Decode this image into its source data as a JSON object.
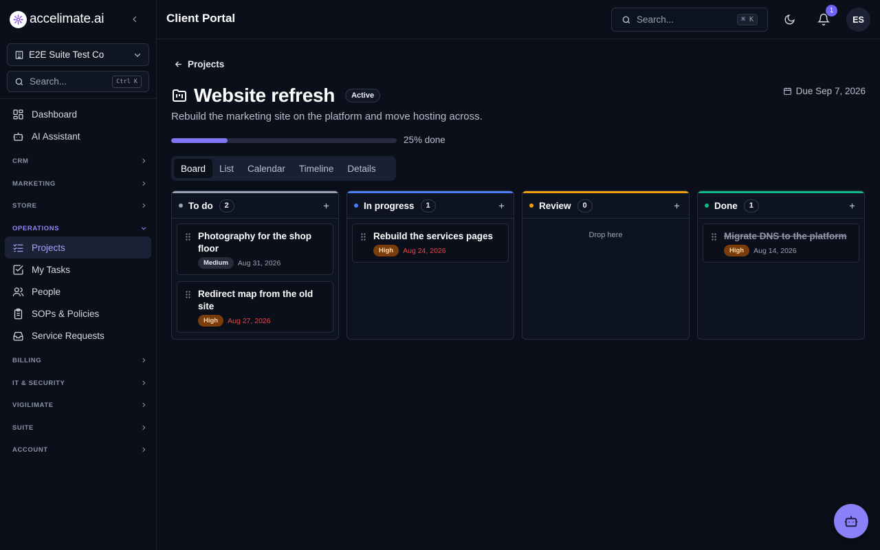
{
  "brand": {
    "name": "accelimate.ai"
  },
  "org": {
    "name": "E2E Suite Test Co"
  },
  "sidebar_search": {
    "placeholder": "Search...",
    "shortcut": "Ctrl K"
  },
  "sidebar": {
    "top_items": [
      {
        "label": "Dashboard",
        "icon": "dashboard-icon"
      },
      {
        "label": "AI Assistant",
        "icon": "robot-icon"
      }
    ],
    "sections": [
      {
        "label": "CRM"
      },
      {
        "label": "MARKETING"
      },
      {
        "label": "STORE"
      },
      {
        "label": "OPERATIONS"
      },
      {
        "label": "BILLING"
      },
      {
        "label": "IT & SECURITY"
      },
      {
        "label": "VIGILIMATE"
      },
      {
        "label": "SUITE"
      },
      {
        "label": "ACCOUNT"
      }
    ],
    "operations_items": [
      {
        "label": "Projects",
        "icon": "list-checks-icon",
        "active": true
      },
      {
        "label": "My Tasks",
        "icon": "square-check-icon"
      },
      {
        "label": "People",
        "icon": "users-icon"
      },
      {
        "label": "SOPs & Policies",
        "icon": "clipboard-icon"
      },
      {
        "label": "Service Requests",
        "icon": "inbox-icon"
      }
    ]
  },
  "topbar": {
    "title": "Client Portal",
    "search_placeholder": "Search...",
    "search_shortcut": "⌘ K",
    "notification_count": "1",
    "avatar_initials": "ES"
  },
  "project": {
    "back_label": "Projects",
    "title": "Website refresh",
    "status": "Active",
    "due": "Due Sep 7, 2026",
    "description": "Rebuild the marketing site on the platform and move hosting across.",
    "progress_percent": 25,
    "progress_label": "25% done"
  },
  "tabs": [
    {
      "label": "Board",
      "active": true
    },
    {
      "label": "List"
    },
    {
      "label": "Calendar"
    },
    {
      "label": "Timeline"
    },
    {
      "label": "Details"
    }
  ],
  "board": {
    "drop_label": "Drop here",
    "columns": [
      {
        "title": "To do",
        "count": "2",
        "color": "#9aa3b5",
        "cards": [
          {
            "title": "Photography for the shop floor",
            "priority": "Medium",
            "date": "Aug 31, 2026",
            "overdue": false
          },
          {
            "title": "Redirect map from the old site",
            "priority": "High",
            "date": "Aug 27, 2026",
            "overdue": true
          }
        ]
      },
      {
        "title": "In progress",
        "count": "1",
        "color": "#4f7cf7",
        "cards": [
          {
            "title": "Rebuild the services pages",
            "priority": "High",
            "date": "Aug 24, 2026",
            "overdue": true
          }
        ]
      },
      {
        "title": "Review",
        "count": "0",
        "color": "#f59e0b",
        "cards": []
      },
      {
        "title": "Done",
        "count": "1",
        "color": "#10b981",
        "cards": [
          {
            "title": "Migrate DNS to the platform",
            "priority": "High",
            "date": "Aug 14, 2026",
            "overdue": false,
            "done": true
          }
        ]
      }
    ]
  },
  "colors": {
    "accent": "#8176f5",
    "background": "#0b0f1a"
  }
}
